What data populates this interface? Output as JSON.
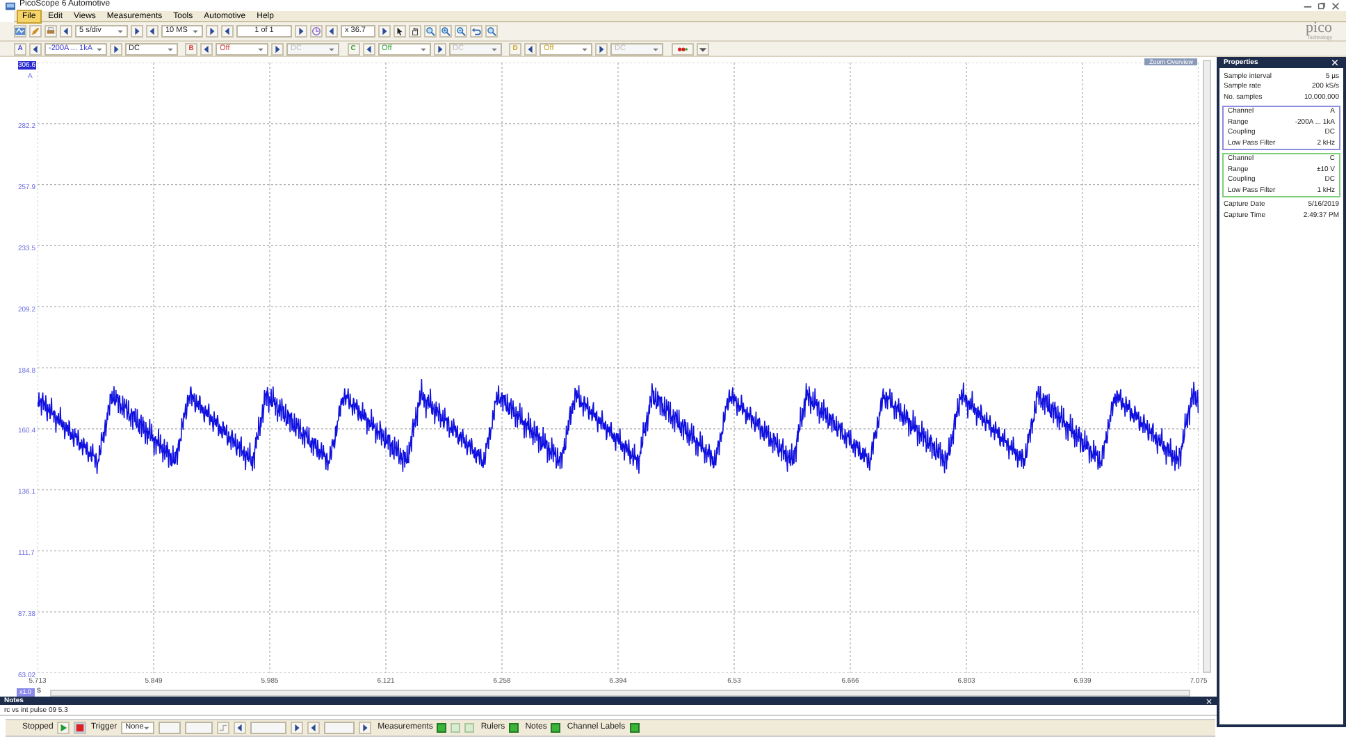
{
  "window": {
    "title": "PicoScope 6 Automotive"
  },
  "menu": [
    {
      "label": "File",
      "selected": true
    },
    {
      "label": "Edit",
      "selected": false
    },
    {
      "label": "Views",
      "selected": false
    },
    {
      "label": "Measurements",
      "selected": false
    },
    {
      "label": "Tools",
      "selected": false
    },
    {
      "label": "Automotive",
      "selected": false
    },
    {
      "label": "Help",
      "selected": false
    }
  ],
  "toolbar": {
    "timebase": "5 s/div",
    "samples": "10 MS",
    "buffer": "1 of 1",
    "zoom": "x 36.7"
  },
  "channels": [
    {
      "letter": "A",
      "range": "-200A ... 1kA",
      "coupling": "DC",
      "enabled": true,
      "color": "#3a3ad0"
    },
    {
      "letter": "B",
      "range": "Off",
      "coupling": "DC",
      "enabled": false,
      "color": "#d03a3a"
    },
    {
      "letter": "C",
      "range": "Off",
      "coupling": "DC",
      "enabled": false,
      "color": "#2fa02f"
    },
    {
      "letter": "D",
      "range": "Off",
      "coupling": "DC",
      "enabled": false,
      "color": "#c8a020"
    }
  ],
  "scope": {
    "overview_title": "Zoom Overview",
    "y_unit": "A",
    "y_labels": [
      "306.6",
      "282.2",
      "257.9",
      "233.5",
      "209.2",
      "184.8",
      "160.4",
      "136.1",
      "111.7",
      "87.38",
      "63.02"
    ],
    "x_labels": [
      "5.713",
      "5.849",
      "5.985",
      "6.121",
      "6.258",
      "6.394",
      "6.53",
      "6.666",
      "6.803",
      "6.939",
      "7.075"
    ],
    "x_unit": "s",
    "zoom_badge": "x1.0"
  },
  "properties": {
    "title": "Properties",
    "rows": [
      {
        "label": "Sample interval",
        "value": "5 µs"
      },
      {
        "label": "Sample rate",
        "value": "200 kS/s"
      },
      {
        "label": "No. samples",
        "value": "10,000,000"
      }
    ],
    "groups": [
      {
        "color": "#8c8ce0",
        "rows": [
          {
            "label": "Channel",
            "value": "A"
          },
          {
            "label": "Range",
            "value": "-200A ... 1kA"
          },
          {
            "label": "Coupling",
            "value": "DC"
          },
          {
            "label": "Low Pass Filter",
            "value": "2 kHz"
          }
        ]
      },
      {
        "color": "#7cd07c",
        "rows": [
          {
            "label": "Channel",
            "value": "C"
          },
          {
            "label": "Range",
            "value": "±10 V"
          },
          {
            "label": "Coupling",
            "value": "DC"
          },
          {
            "label": "Low Pass Filter",
            "value": "1 kHz"
          }
        ]
      }
    ],
    "capture": [
      {
        "label": "Capture Date",
        "value": "5/16/2019"
      },
      {
        "label": "Capture Time",
        "value": "2:49:37 PM"
      }
    ]
  },
  "notes": {
    "title": "Notes",
    "text": "rc vs int pulse 09 5.3"
  },
  "status": {
    "state": "Stopped",
    "trigger_label": "Trigger",
    "trigger": "None",
    "toggles": [
      "Measurements",
      "Rulers",
      "Notes",
      "Channel Labels"
    ]
  },
  "logo": {
    "name": "pico",
    "tagline": "Technology"
  }
}
